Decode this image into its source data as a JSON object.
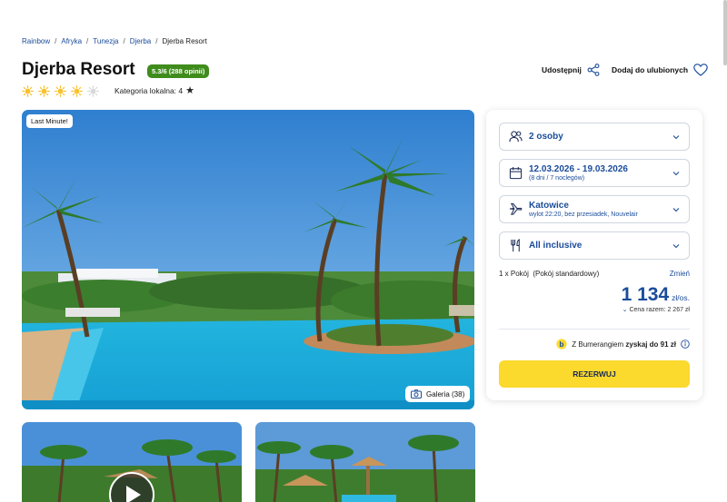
{
  "breadcrumb": [
    "Rainbow",
    "Afryka",
    "Tunezja",
    "Djerba",
    "Djerba Resort"
  ],
  "hotel": {
    "name": "Djerba Resort",
    "rating": "5.3/6 (288 opinii)",
    "suns_filled": 4,
    "suns_total": 5,
    "local_category": "Kategoria lokalna: 4"
  },
  "actions": {
    "share": "Udostępnij",
    "favorite": "Dodaj do ulubionych"
  },
  "gallery": {
    "badge": "Last Minute!",
    "button": "Galeria (38)"
  },
  "booking": {
    "persons": "2 osoby",
    "dates": "12.03.2026 - 19.03.2026",
    "dates_sub": "(8 dni / 7 noclegów)",
    "departure": "Katowice",
    "departure_sub": "wylot 22:20, bez przesiadek, Nouvelair",
    "board": "All inclusive",
    "room": "1 x Pokój  (Pokój standardowy)",
    "room_change": "Zmień",
    "price": "1 134",
    "price_unit": "zł/os.",
    "total": "Cena razem: 2 267 zł",
    "bumerang_prefix": "Z Bumerangiem",
    "bumerang_bold": "zyskaj do 91 zł",
    "reserve": "REZERWUJ"
  },
  "colors": {
    "brand_blue": "#1a4c9a",
    "rating_green": "#3f8c1d",
    "cta_yellow": "#fbd92d",
    "sun": "#f9c22e"
  }
}
